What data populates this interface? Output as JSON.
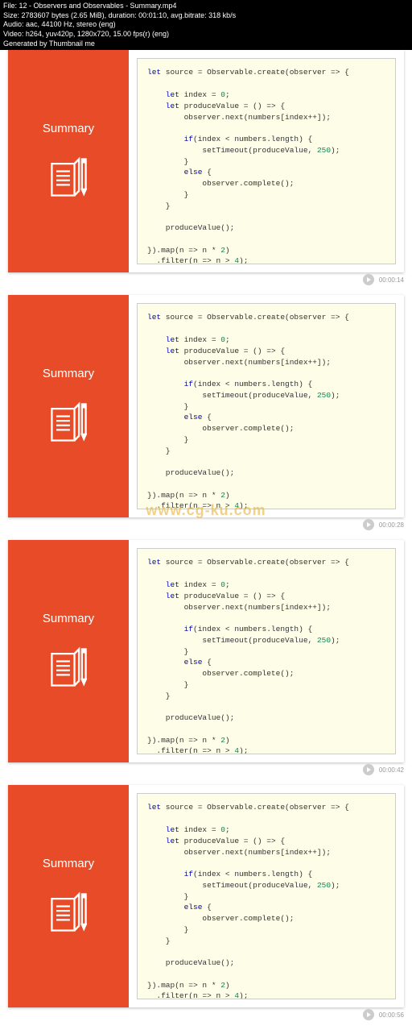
{
  "meta": {
    "line1": "File: 12 - Observers and Observables - Summary.mp4",
    "line2": "Size: 2783607 bytes (2.65 MiB), duration: 00:01:10, avg.bitrate: 318 kb/s",
    "line3": "Audio: aac, 44100 Hz, stereo (eng)",
    "line4": "Video: h264, yuv420p, 1280x720, 15.00 fps(r) (eng)",
    "line5": "Generated by Thumbnail me"
  },
  "panel_title": "Summary",
  "watermark": "www.cg-ku.com",
  "code": {
    "l1a": "let",
    "l1b": " source = Observable.create(observer => {",
    "l2": "",
    "l3a": "    let",
    "l3b": " index = ",
    "l3c": "0",
    "l3d": ";",
    "l4a": "    let",
    "l4b": " produceValue = () => {",
    "l5": "        observer.next(numbers[index++]);",
    "l6": "",
    "l7a": "        if",
    "l7b": "(index < numbers.length) {",
    "l8a": "            setTimeout(produceValue, ",
    "l8b": "250",
    "l8c": ");",
    "l9": "        }",
    "l10a": "        else",
    "l10b": " {",
    "l11": "            observer.complete();",
    "l12": "        }",
    "l13": "    }",
    "l14": "",
    "l15": "    produceValue();",
    "l16": "",
    "l17a": "}).map(n => n * ",
    "l17b": "2",
    "l17c": ")",
    "l18a": "  .filter(n => n > ",
    "l18b": "4",
    "l18c": ");"
  },
  "thumbs": [
    {
      "timestamp": "00:00:14"
    },
    {
      "timestamp": "00:00:28"
    },
    {
      "timestamp": "00:00:42"
    },
    {
      "timestamp": "00:00:56"
    }
  ]
}
